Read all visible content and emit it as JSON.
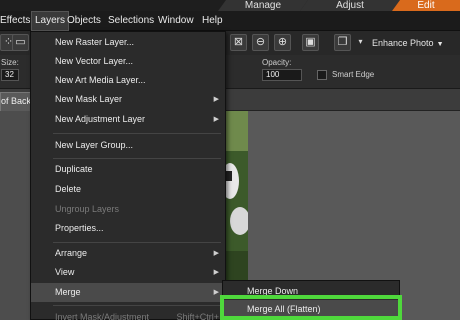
{
  "workspace_tabs": {
    "manage": "Manage",
    "adjust": "Adjust",
    "edit": "Edit"
  },
  "menubar": {
    "items": [
      "Effects",
      "Layers",
      "Objects",
      "Selections",
      "Window",
      "Help"
    ]
  },
  "toolbar": {
    "enhance_label": "Enhance Photo"
  },
  "options": {
    "size_label": "Size:",
    "size_value": "32",
    "opacity_label": "Opacity:",
    "opacity_value": "100",
    "smart_edge_label": "Smart Edge"
  },
  "document_tab": {
    "title": "of Backgr"
  },
  "layers_menu": {
    "items": [
      {
        "label": "New Raster Layer...",
        "disabled": false
      },
      {
        "label": "New Vector Layer...",
        "disabled": false
      },
      {
        "label": "New Art Media Layer...",
        "disabled": false
      },
      {
        "label": "New Mask Layer",
        "disabled": false,
        "submenu": true
      },
      {
        "label": "New Adjustment Layer",
        "disabled": false,
        "submenu": true
      },
      {
        "label": "New Layer Group...",
        "disabled": false
      },
      {
        "label": "Duplicate",
        "disabled": false
      },
      {
        "label": "Delete",
        "disabled": false
      },
      {
        "label": "Ungroup Layers",
        "disabled": true
      },
      {
        "label": "Properties...",
        "disabled": false
      },
      {
        "label": "Arrange",
        "disabled": false,
        "submenu": true
      },
      {
        "label": "View",
        "disabled": false,
        "submenu": true
      },
      {
        "label": "Merge",
        "disabled": false,
        "submenu": true,
        "highlighted": true
      },
      {
        "label": "Invert Mask/Adjustment",
        "disabled": true,
        "shortcut": "Shift+Ctrl+"
      }
    ]
  },
  "merge_submenu": {
    "items": [
      {
        "label": "Merge Down"
      },
      {
        "label": "Merge All (Flatten)",
        "selected": true
      }
    ]
  },
  "colors": {
    "accent_orange": "#d96a1c",
    "highlight_green": "#4fd83c",
    "menu_bg": "#2b2b2b"
  }
}
